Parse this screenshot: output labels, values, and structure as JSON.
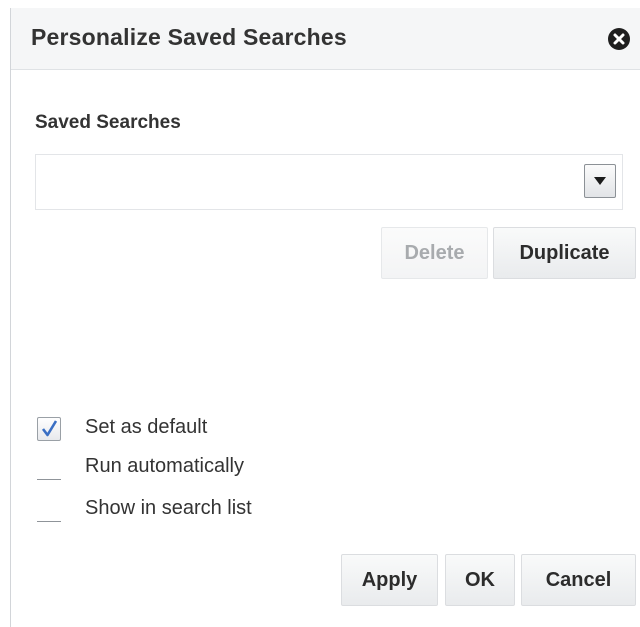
{
  "dialog": {
    "title": "Personalize Saved Searches",
    "close_icon": "close-circle-icon"
  },
  "saved_searches": {
    "label": "Saved Searches",
    "selected_value": "",
    "dropdown_icon": "triangle-down-icon"
  },
  "actions": {
    "delete_label": "Delete",
    "duplicate_label": "Duplicate"
  },
  "options": [
    {
      "label": "Set as default",
      "checked": true
    },
    {
      "label": "Run automatically",
      "checked": false
    },
    {
      "label": "Show in search list",
      "checked": false
    }
  ],
  "footer": {
    "apply_label": "Apply",
    "ok_label": "OK",
    "cancel_label": "Cancel"
  },
  "colors": {
    "checkmark": "#3a6fc4",
    "title_text": "#333333"
  }
}
